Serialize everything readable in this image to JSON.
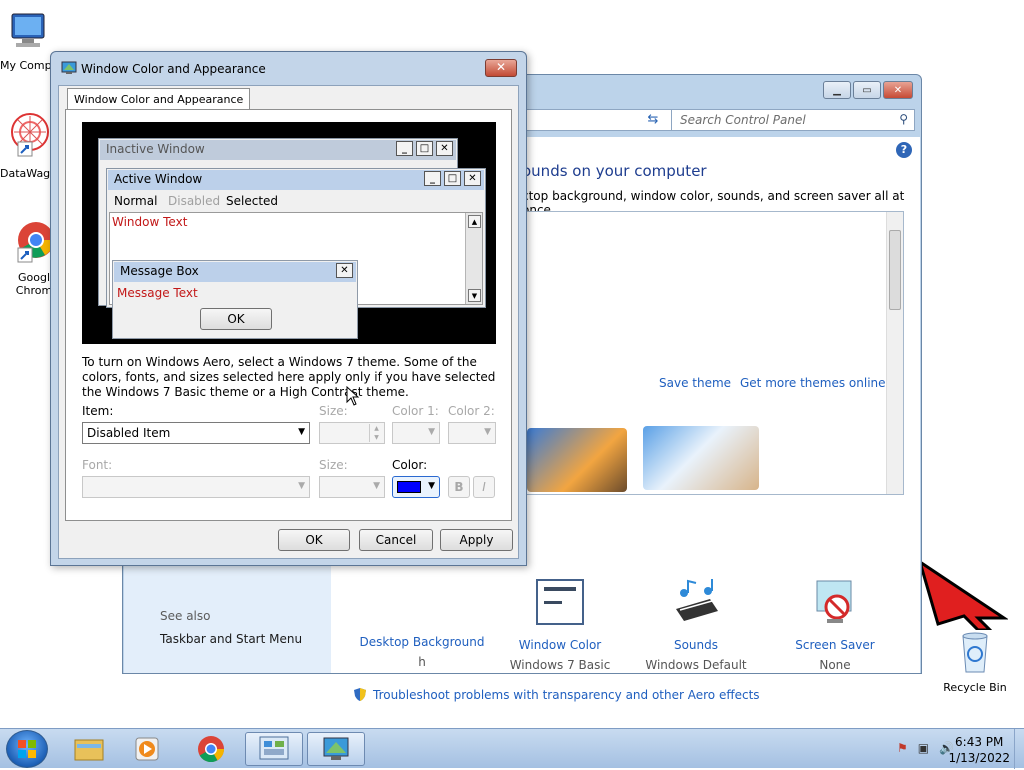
{
  "desktop": {
    "icons": [
      {
        "label": "My Comp"
      },
      {
        "label": "DataWag"
      },
      {
        "label": "Googl Chrom"
      },
      {
        "label": "Recycle Bin"
      }
    ]
  },
  "control_panel": {
    "search_placeholder": "Search Control Panel",
    "heading": "ounds on your computer",
    "subheading": "ctop background, window color, sounds, and screen saver all at once.",
    "save_theme": "Save theme",
    "get_more_themes": "Get more themes online",
    "see_also": "See also",
    "taskbar_link": "Taskbar and Start Menu",
    "troubleshoot": "Troubleshoot problems with transparency and other Aero effects",
    "bottom_items": [
      {
        "title": "Desktop Background",
        "sub": "h"
      },
      {
        "title": "Window Color",
        "sub": "Windows 7 Basic"
      },
      {
        "title": "Sounds",
        "sub": "Windows Default"
      },
      {
        "title": "Screen Saver",
        "sub": "None"
      }
    ]
  },
  "dialog": {
    "title": "Window Color and Appearance",
    "tab": "Window Color and Appearance",
    "preview": {
      "inactive_window": "Inactive Window",
      "active_window": "Active Window",
      "menu_normal": "Normal",
      "menu_disabled": "Disabled",
      "menu_selected": "Selected",
      "window_text": "Window Text",
      "message_box": "Message Box",
      "message_text": "Message Text",
      "ok": "OK"
    },
    "info_text": "To turn on Windows Aero, select a Windows 7 theme.  Some of the colors, fonts, and sizes selected here apply only if you have selected the Windows 7 Basic theme or a High Contrast theme.",
    "item_label": "Item:",
    "item_value": "Disabled Item",
    "size_label": "Size:",
    "color1_label": "Color 1:",
    "color2_label": "Color 2:",
    "font_label": "Font:",
    "size2_label": "Size:",
    "color_label": "Color:",
    "color_value": "#0000ff",
    "bold_label": "B",
    "italic_label": "I",
    "buttons": {
      "ok": "OK",
      "cancel": "Cancel",
      "apply": "Apply"
    }
  },
  "taskbar": {
    "time": "6:43 PM",
    "date": "1/13/2022"
  }
}
